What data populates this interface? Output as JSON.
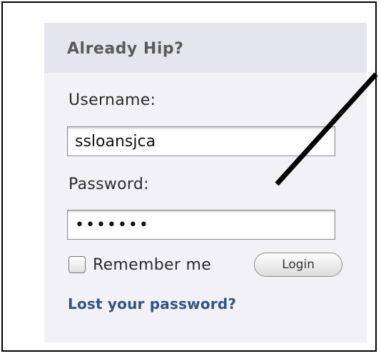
{
  "panel": {
    "title": "Already Hip?"
  },
  "form": {
    "username_label": "Username:",
    "username_value": "ssloansjca",
    "password_label": "Password:",
    "password_value": "•••••••",
    "remember_label": "Remember me",
    "remember_checked": false,
    "login_label": "Login",
    "lost_password_link": "Lost your password?"
  },
  "colors": {
    "header_bg": "#e5e5ef",
    "panel_bg": "#f2f2f6",
    "link": "#2f5485",
    "arrow": "#000000"
  },
  "icons": {
    "annotation": "arrow-annotation-icon"
  }
}
